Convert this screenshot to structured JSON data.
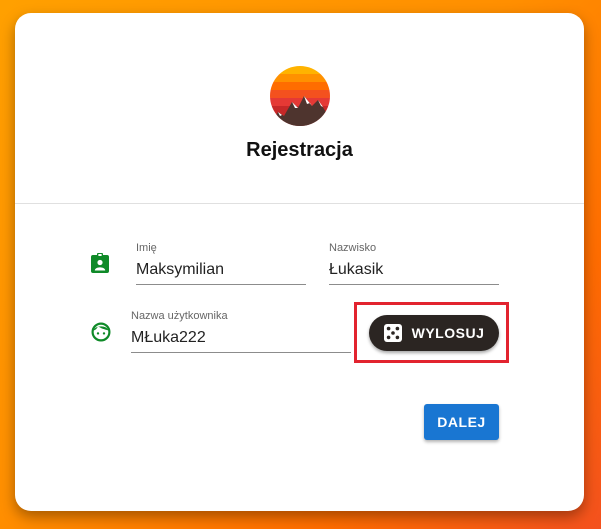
{
  "header": {
    "title": "Rejestracja",
    "logo_icon": "mountain-sunset-logo"
  },
  "form": {
    "first_name": {
      "label": "Imię",
      "value": "Maksymilian"
    },
    "last_name": {
      "label": "Nazwisko",
      "value": "Łukasik"
    },
    "username": {
      "label": "Nazwa użytkownika",
      "value": "MŁuka222"
    },
    "randomize_button": {
      "label": "WYLOSUJ",
      "icon": "dice-icon"
    },
    "next_button": {
      "label": "DALEJ"
    }
  },
  "colors": {
    "icon_green": "#0f8a28",
    "primary_blue": "#1976d2",
    "dark_button": "#2b2522",
    "highlight_red": "#e2232f",
    "background_orange": "#ff8f00"
  }
}
